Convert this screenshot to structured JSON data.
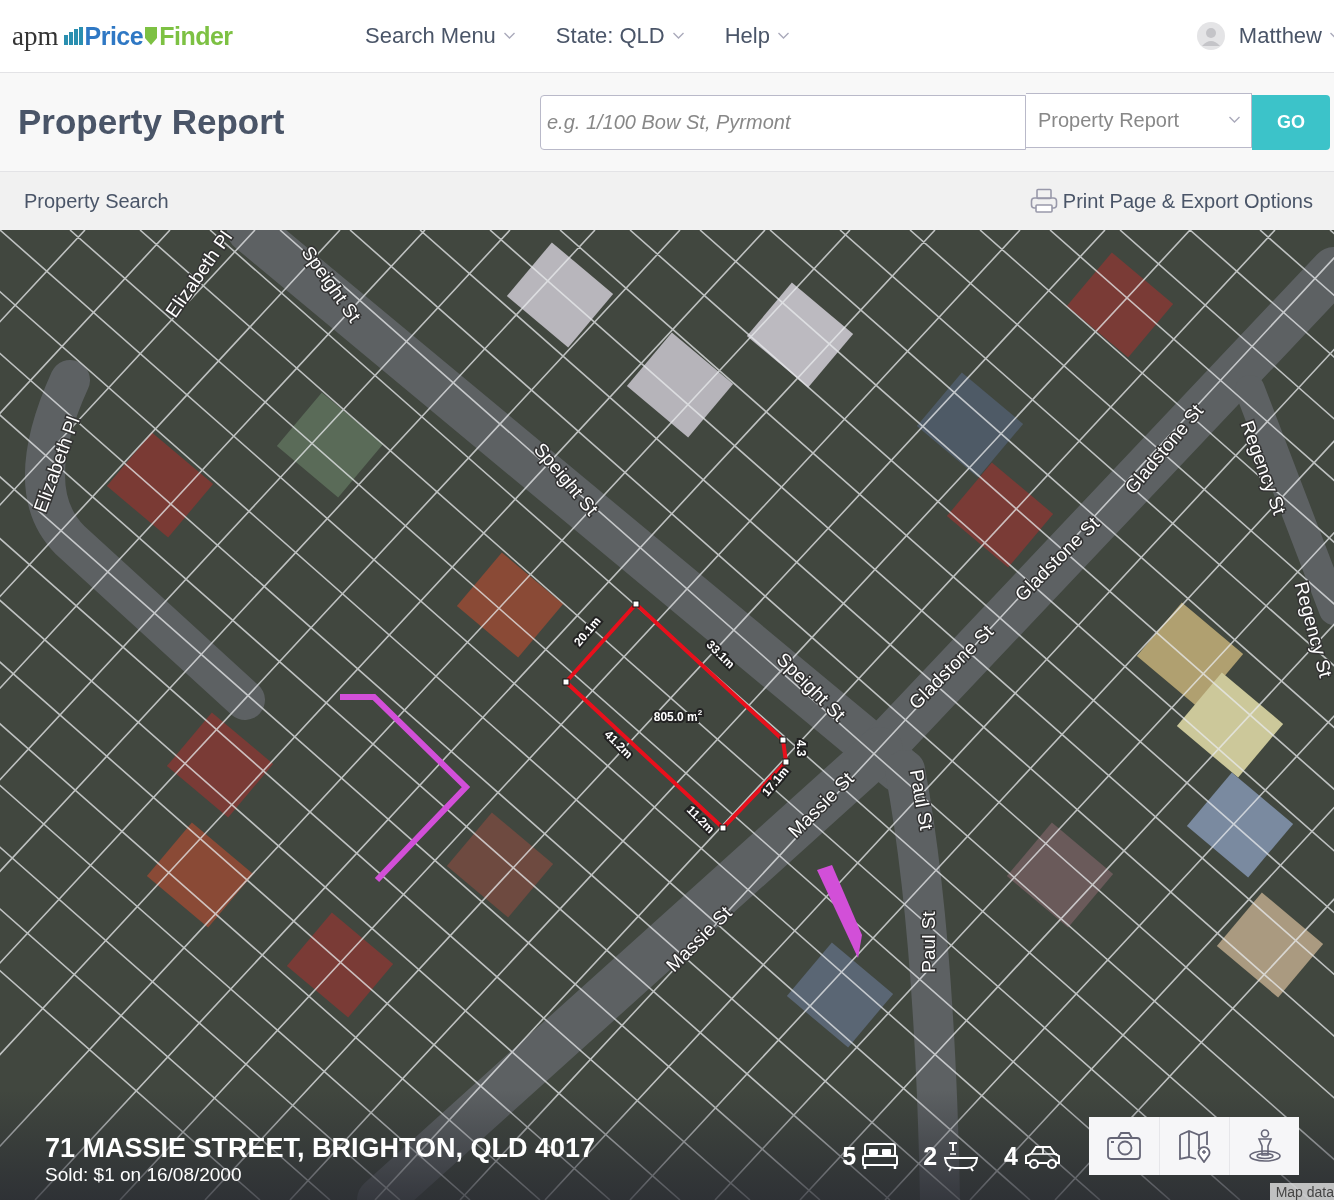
{
  "header": {
    "logo": {
      "prefix": "apm",
      "word_1": "Price",
      "word_2": "Finder"
    },
    "nav": [
      {
        "label": "Search Menu"
      },
      {
        "label": "State: QLD"
      },
      {
        "label": "Help"
      }
    ],
    "user": {
      "name": "Matthew"
    }
  },
  "title_bar": {
    "title": "Property Report",
    "search": {
      "placeholder": "e.g. 1/100 Bow St, Pyrmont"
    },
    "report_type": {
      "value": "Property Report"
    },
    "go_button": "GO"
  },
  "sub_bar": {
    "breadcrumb": "Property Search",
    "print_link": "Print Page & Export Options"
  },
  "map": {
    "street_labels": [
      "Elizabeth Pl",
      "Speight St",
      "Elizabeth Pl",
      "Speight St",
      "Speight St",
      "Gladstone St",
      "Gladstone St",
      "Gladstone St",
      "Regency St",
      "Regency St",
      "Massie St",
      "Massie St",
      "Paul St",
      "Paul St"
    ],
    "measurements": [
      "20.1m",
      "33.1m",
      "805.0 m$^{2}$",
      "41.2m",
      "4.3",
      "17.1m",
      "11.2m"
    ],
    "attribution": "Map data",
    "address": "71 MASSIE STREET, BRIGHTON, QLD 4017",
    "sold": "Sold: $1 on 16/08/2000",
    "features": [
      {
        "kind": "bed",
        "count": "5"
      },
      {
        "kind": "bath",
        "count": "2"
      },
      {
        "kind": "car",
        "count": "4"
      }
    ],
    "buttons": [
      {
        "kind": "camera"
      },
      {
        "kind": "map"
      },
      {
        "kind": "streetview"
      }
    ]
  }
}
